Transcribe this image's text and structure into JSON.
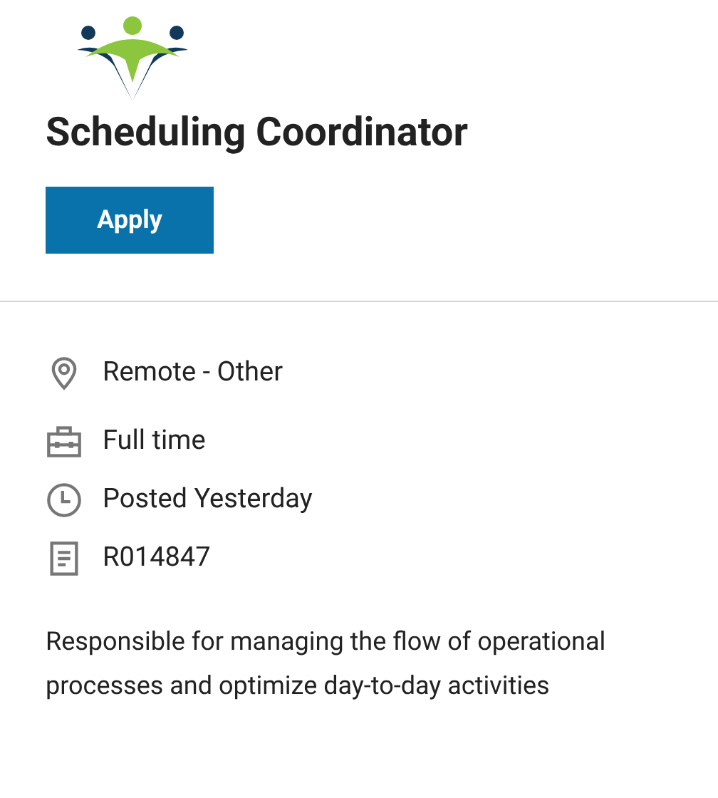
{
  "job": {
    "title": "Scheduling Coordinator"
  },
  "apply_button": {
    "label": "Apply"
  },
  "details": [
    {
      "kind": "location",
      "text": "Remote - Other"
    },
    {
      "kind": "job_type",
      "text": "Full time"
    },
    {
      "kind": "posted",
      "text": "Posted Yesterday"
    },
    {
      "kind": "requisition",
      "text": "R014847"
    }
  ],
  "description": "Responsible for managing the flow of operational processes and optimize day-to-day activities"
}
